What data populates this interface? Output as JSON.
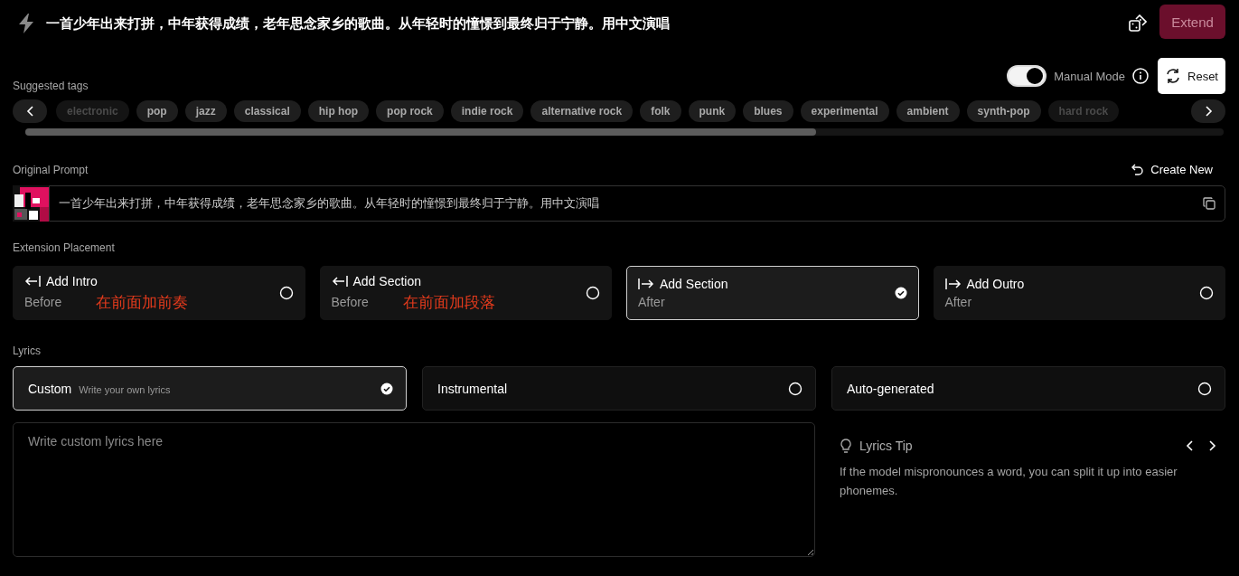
{
  "header": {
    "title": "一首少年出来打拼，中年获得成绩，老年思念家乡的歌曲。从年轻时的憧憬到最终归于宁静。用中文演唱",
    "extend_button": "Extend"
  },
  "manual_mode": {
    "label": "Manual Mode",
    "on": true
  },
  "reset_button": "Reset",
  "suggested_tags": {
    "label": "Suggested tags",
    "tags": [
      {
        "label": "electronic",
        "faded": true
      },
      {
        "label": "pop",
        "faded": false
      },
      {
        "label": "jazz",
        "faded": false
      },
      {
        "label": "classical",
        "faded": false
      },
      {
        "label": "hip hop",
        "faded": false
      },
      {
        "label": "pop rock",
        "faded": false
      },
      {
        "label": "indie rock",
        "faded": false
      },
      {
        "label": "alternative rock",
        "faded": false
      },
      {
        "label": "folk",
        "faded": false
      },
      {
        "label": "punk",
        "faded": false
      },
      {
        "label": "blues",
        "faded": false
      },
      {
        "label": "experimental",
        "faded": false
      },
      {
        "label": "ambient",
        "faded": false
      },
      {
        "label": "synth-pop",
        "faded": false
      },
      {
        "label": "hard rock",
        "faded": true
      }
    ]
  },
  "original_prompt": {
    "label": "Original Prompt",
    "create_new": "Create New",
    "value": "一首少年出来打拼，中年获得成绩，老年思念家乡的歌曲。从年轻时的憧憬到最终归于宁静。用中文演唱"
  },
  "extension_placement": {
    "label": "Extension Placement",
    "options": [
      {
        "title": "Add Intro",
        "subtitle": "Before",
        "kind": "before",
        "note": "在前面加前奏",
        "selected": false
      },
      {
        "title": "Add Section",
        "subtitle": "Before",
        "kind": "before",
        "note": "在前面加段落",
        "selected": false
      },
      {
        "title": "Add Section",
        "subtitle": "After",
        "kind": "after",
        "selected": true
      },
      {
        "title": "Add Outro",
        "subtitle": "After",
        "kind": "after",
        "selected": false
      }
    ]
  },
  "lyrics": {
    "label": "Lyrics",
    "options": [
      {
        "title": "Custom",
        "hint": "Write your own lyrics",
        "selected": true
      },
      {
        "title": "Instrumental",
        "selected": false
      },
      {
        "title": "Auto-generated",
        "selected": false
      }
    ],
    "placeholder": "Write custom lyrics here",
    "tip": {
      "title": "Lyrics Tip",
      "text": "If the model mispronounces a word, you can split it up into easier phonemes."
    }
  }
}
